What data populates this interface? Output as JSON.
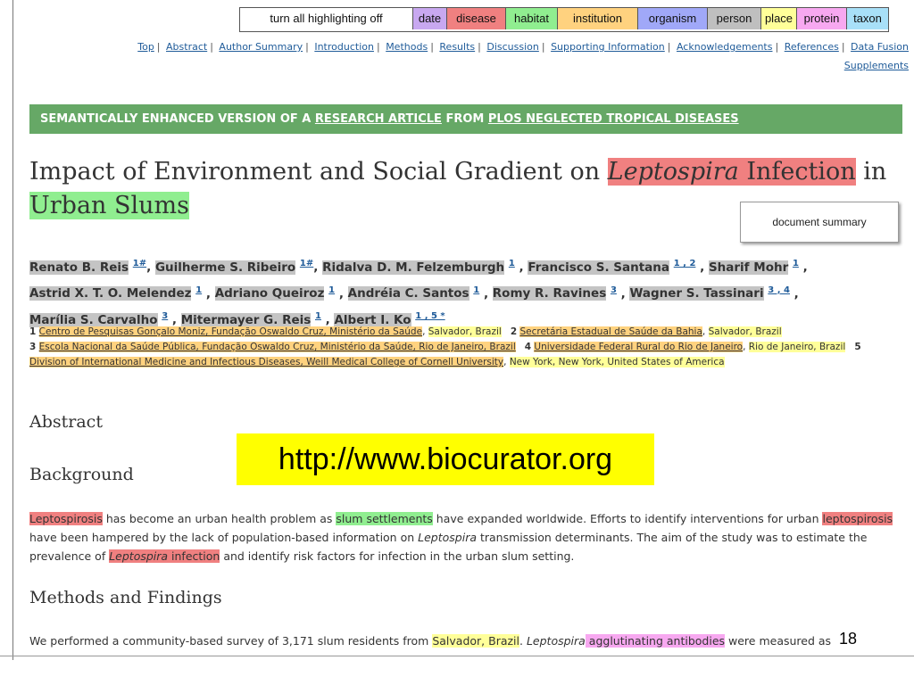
{
  "toolbar": {
    "off_label": "turn all highlighting off",
    "buttons": [
      {
        "label": "date",
        "color": "#c8a8f0",
        "width": 38
      },
      {
        "label": "disease",
        "color": "#f08080",
        "width": 66
      },
      {
        "label": "habitat",
        "color": "#90ee90",
        "width": 58
      },
      {
        "label": "institution",
        "color": "#ffd27f",
        "width": 90
      },
      {
        "label": "organism",
        "color": "#a0a8f8",
        "width": 78
      },
      {
        "label": "person",
        "color": "#bfbfbf",
        "width": 60
      },
      {
        "label": "place",
        "color": "#ffff99",
        "width": 40
      },
      {
        "label": "protein",
        "color": "#f7a8f0",
        "width": 56
      },
      {
        "label": "taxon",
        "color": "#a8e0f8",
        "width": 46
      }
    ]
  },
  "nav": [
    "Top",
    "Abstract",
    "Author Summary",
    "Introduction",
    "Methods",
    "Results",
    "Discussion",
    "Supporting Information",
    "Acknowledgements",
    "References",
    "Data Fusion",
    "Supplements"
  ],
  "banner": {
    "prefix": "SEMANTICALLY ENHANCED VERSION OF A ",
    "link1": "RESEARCH ARTICLE",
    "mid": " FROM ",
    "link2": "PLOS NEGLECTED TROPICAL DISEASES"
  },
  "title": {
    "part1": "Impact of Environment and Social Gradient on ",
    "organism": "Leptospira",
    "disease_tail": " Infection",
    "part2": " in ",
    "habitat": "Urban Slums"
  },
  "doc_summary": "document summary",
  "authors": [
    {
      "name": "Renato B. Reis",
      "sup": "1#"
    },
    {
      "name": "Guilherme S. Ribeiro",
      "sup": "1#"
    },
    {
      "name": "Ridalva D. M. Felzemburgh",
      "sup": "1"
    },
    {
      "name": "Francisco S. Santana",
      "sup": "1 , 2"
    },
    {
      "name": "Sharif Mohr",
      "sup": "1"
    },
    {
      "name": "Astrid X. T. O. Melendez",
      "sup": "1"
    },
    {
      "name": "Adriano Queiroz",
      "sup": "1"
    },
    {
      "name": "Andréia C. Santos",
      "sup": "1"
    },
    {
      "name": "Romy R. Ravines",
      "sup": "3"
    },
    {
      "name": "Wagner S. Tassinari",
      "sup": "3 , 4"
    },
    {
      "name": "Marília S. Carvalho",
      "sup": "3"
    },
    {
      "name": "Mitermayer G. Reis",
      "sup": "1"
    },
    {
      "name": "Albert I. Ko",
      "sup": "1 , 5 *"
    }
  ],
  "affiliations": [
    {
      "num": "1",
      "inst": "Centro de Pesquisas Gonçalo Moniz, Fundação Oswaldo Cruz, Ministério da Saúde",
      "place": "Salvador, Brazil"
    },
    {
      "num": "2",
      "inst": "Secretária Estadual de Saúde da Bahia",
      "place": "Salvador, Brazil"
    },
    {
      "num": "3",
      "inst": "Escola Nacional da Saúde Pública, Fundação Oswaldo Cruz, Ministério da Saúde, Rio de Janeiro, Brazil",
      "place": ""
    },
    {
      "num": "4",
      "inst": "Universidade Federal Rural do Rio de Janeiro",
      "place": "Rio de Janeiro, Brazil"
    },
    {
      "num": "5",
      "inst": "Division of International Medicine and Infectious Diseases, Weill Medical College of Cornell University",
      "place": "New York, New York, United States of America"
    }
  ],
  "abstract_heading": "Abstract",
  "background_heading": "Background",
  "url": "http://www.biocurator.org",
  "background": {
    "d1": "Leptospirosis",
    "t1": " has become an urban health problem as ",
    "h1": "slum settlements",
    "t2": " have expanded worldwide. Efforts to identify interventions for urban ",
    "d2": "leptospirosis",
    "t3": " have been hampered by the lack of population-based information on ",
    "o1": "Leptospira",
    "t4": " transmission determinants. The aim of the study was to estimate the prevalence of ",
    "d3a": "Leptospira",
    "d3b": " infection",
    "t5": " and identify risk factors for infection in the urban slum setting."
  },
  "methods_heading": "Methods and Findings",
  "methods": {
    "t1": "We performed a community-based survey of 3,171 slum residents from ",
    "place": "Salvador, Brazil",
    "t2": ". ",
    "o1": "Leptospira",
    "p1": " agglutinating antibodies",
    "t3": " were measured as"
  },
  "page_number": "18"
}
